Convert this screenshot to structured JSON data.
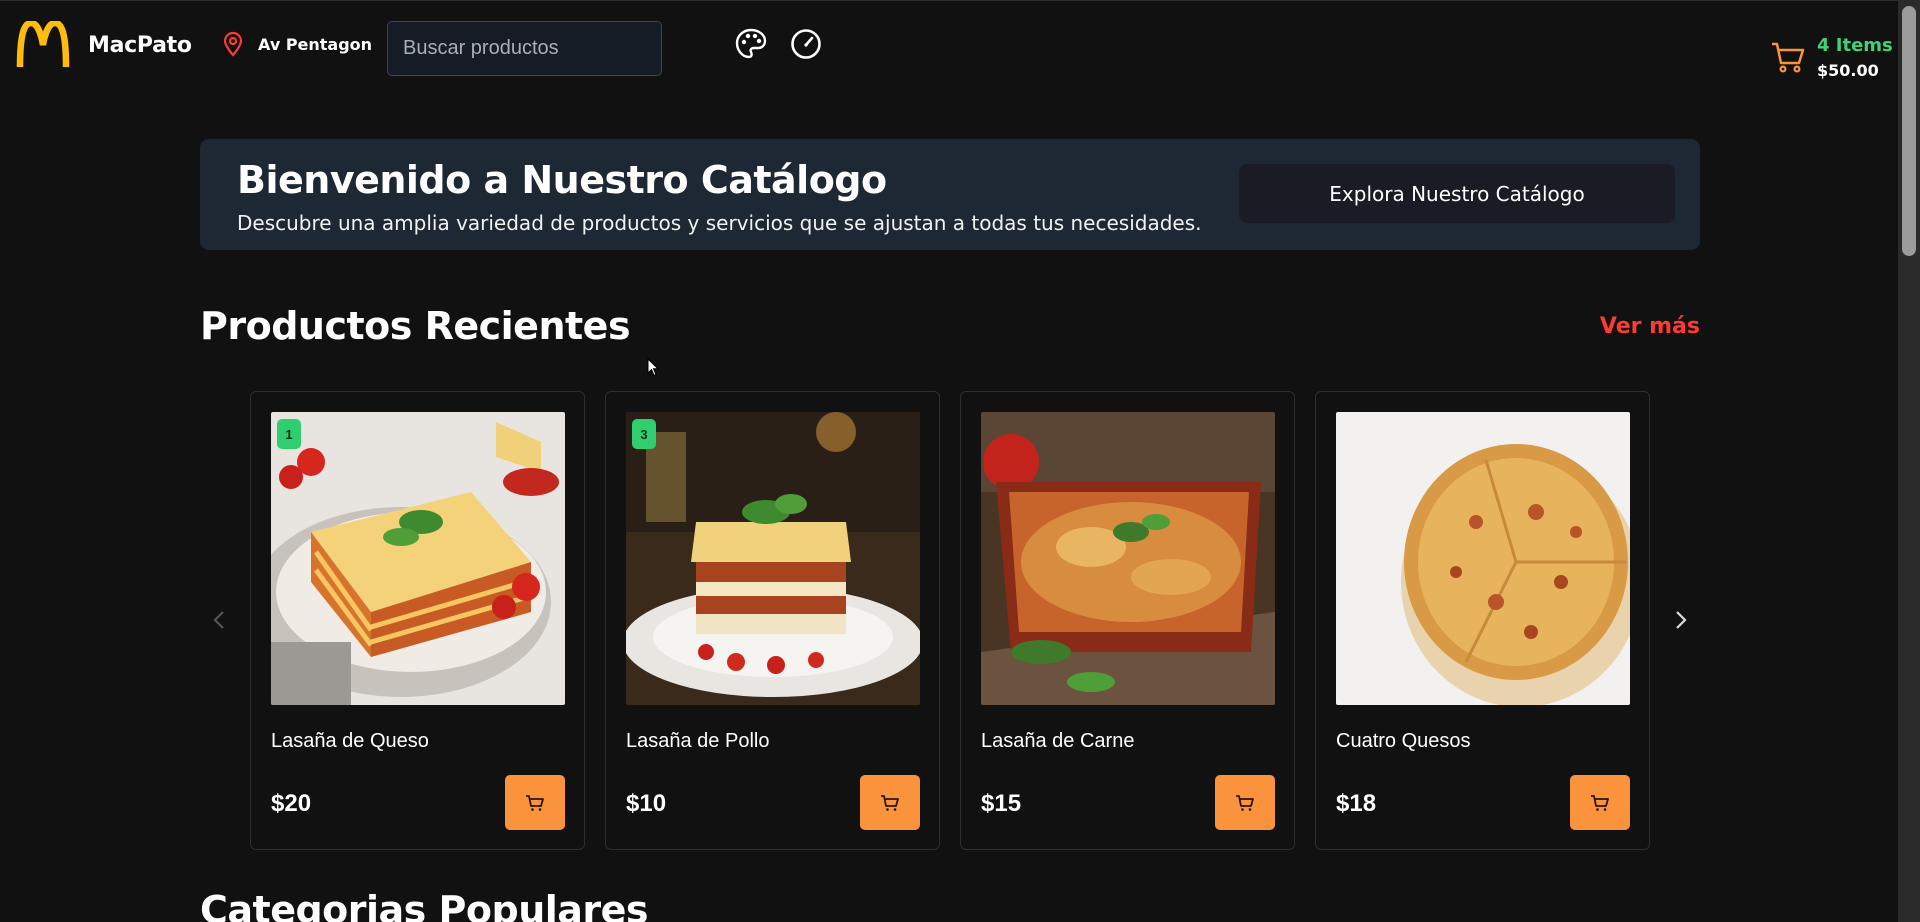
{
  "header": {
    "brand": "MacPato",
    "location": "Av Pentagon",
    "search_placeholder": "Buscar productos",
    "cart_items": "4 Items",
    "cart_total": "$50.00"
  },
  "hero": {
    "title": "Bienvenido a Nuestro Catálogo",
    "subtitle": "Descubre una amplia variedad de productos y servicios que se ajustan a todas tus necesidades.",
    "button": "Explora Nuestro Catálogo"
  },
  "recent": {
    "title": "Productos Recientes",
    "see_more": "Ver más",
    "products": [
      {
        "name": "Lasaña de Queso",
        "price": "$20",
        "badge": "1"
      },
      {
        "name": "Lasaña de Pollo",
        "price": "$10",
        "badge": "3"
      },
      {
        "name": "Lasaña de Carne",
        "price": "$15",
        "badge": ""
      },
      {
        "name": "Cuatro Quesos",
        "price": "$18",
        "badge": ""
      }
    ]
  },
  "popular": {
    "title": "Categorias Populares"
  },
  "colors": {
    "accent_orange": "#fb923c",
    "link_red": "#ff3b2f",
    "badge_green": "#2fcf6f",
    "logo_yellow": "#ffbc0d"
  }
}
